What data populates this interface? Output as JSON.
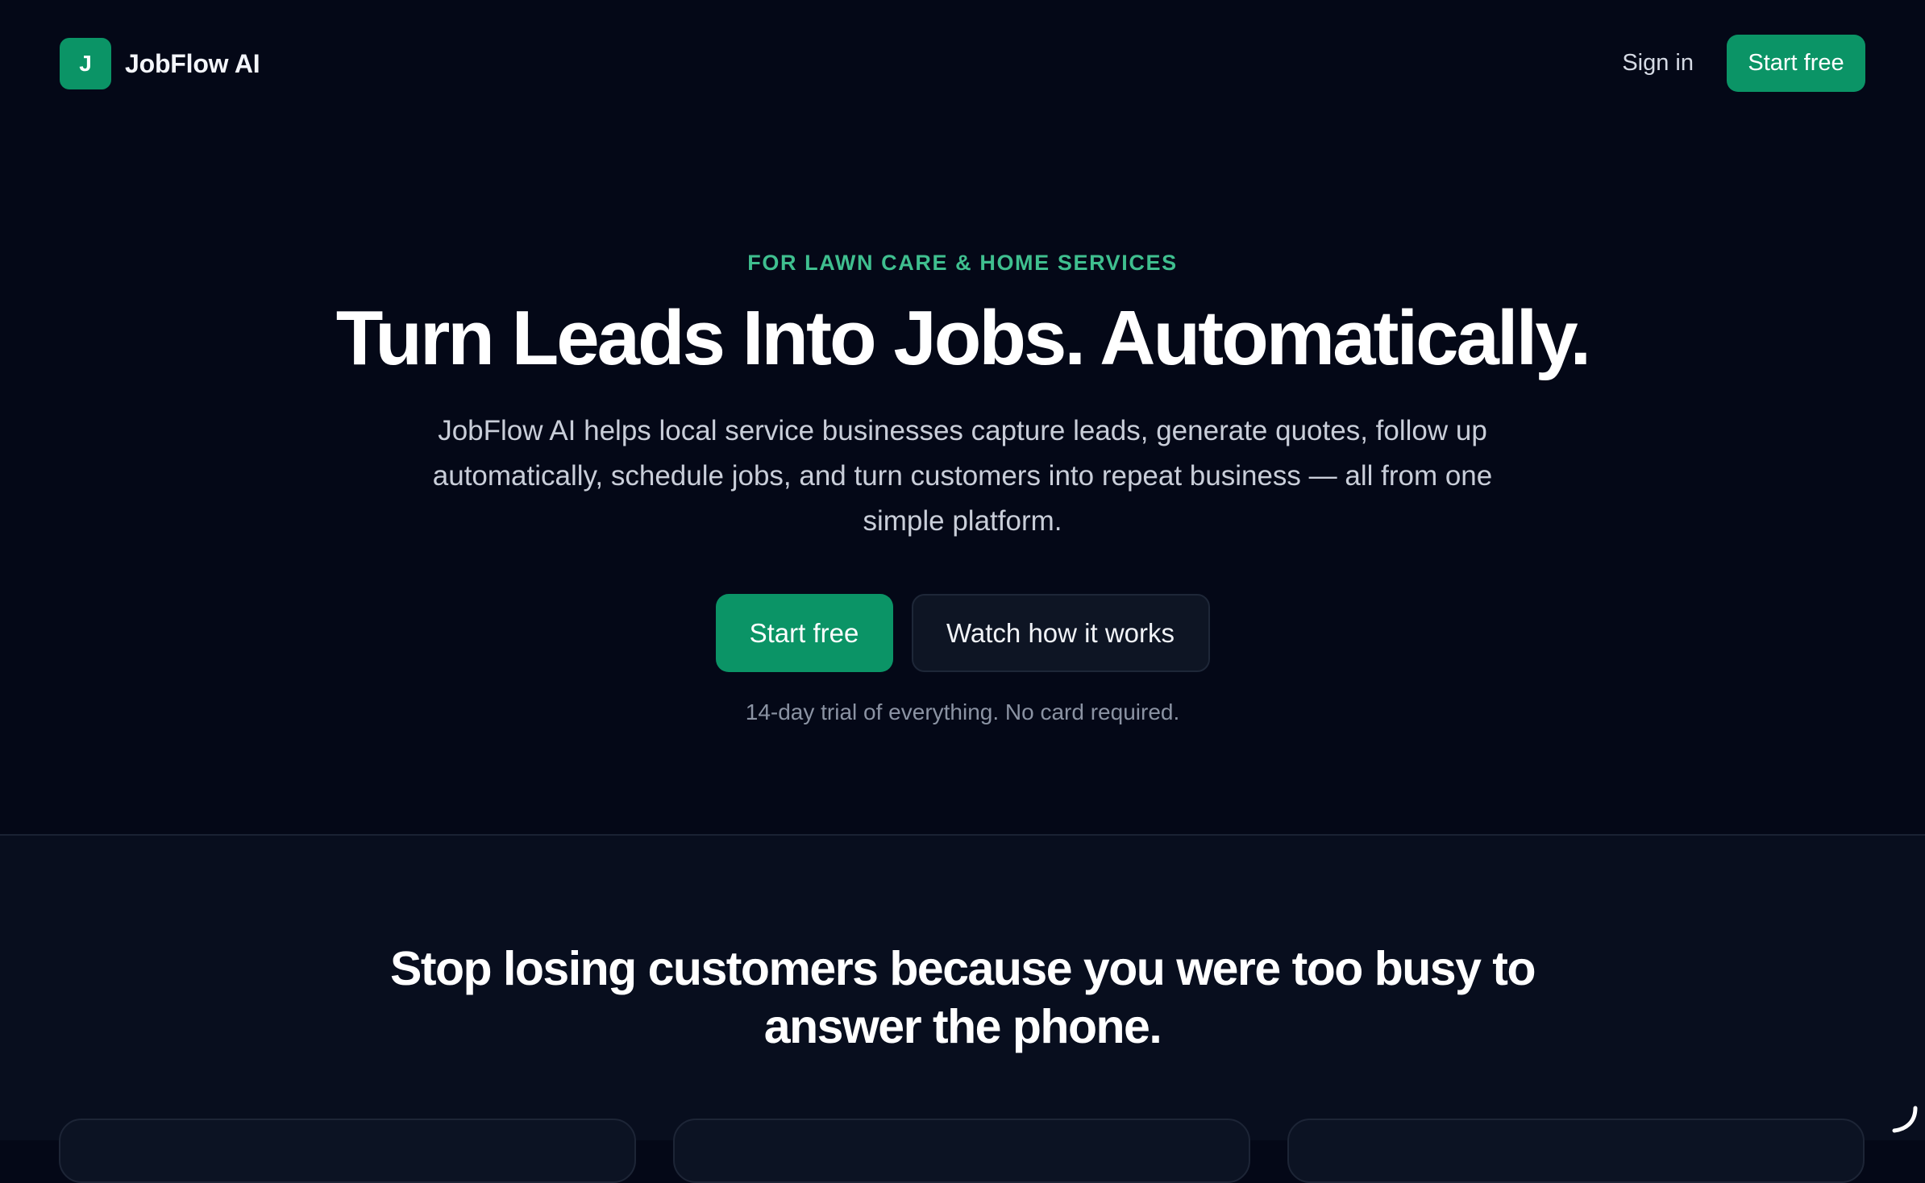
{
  "nav": {
    "logo_letter": "J",
    "brand_name": "JobFlow AI",
    "sign_in_label": "Sign in",
    "start_free_label": "Start free"
  },
  "hero": {
    "eyebrow": "FOR LAWN CARE & HOME SERVICES",
    "title": "Turn Leads Into Jobs. Automatically.",
    "subtitle": "JobFlow AI helps local service businesses capture leads, generate quotes, follow up automatically, schedule jobs, and turn customers into repeat business — all from one simple platform.",
    "primary_cta": "Start free",
    "secondary_cta": "Watch how it works",
    "trial_note": "14-day trial of everything. No card required."
  },
  "section_two": {
    "title": "Stop losing customers because you were too busy to answer the phone."
  },
  "colors": {
    "background": "#040817",
    "section_background": "#080e1e",
    "brand_green": "#0b9466",
    "eyebrow_green": "#3fbf8f"
  },
  "icons": {
    "corner": "loading-arc-icon"
  }
}
